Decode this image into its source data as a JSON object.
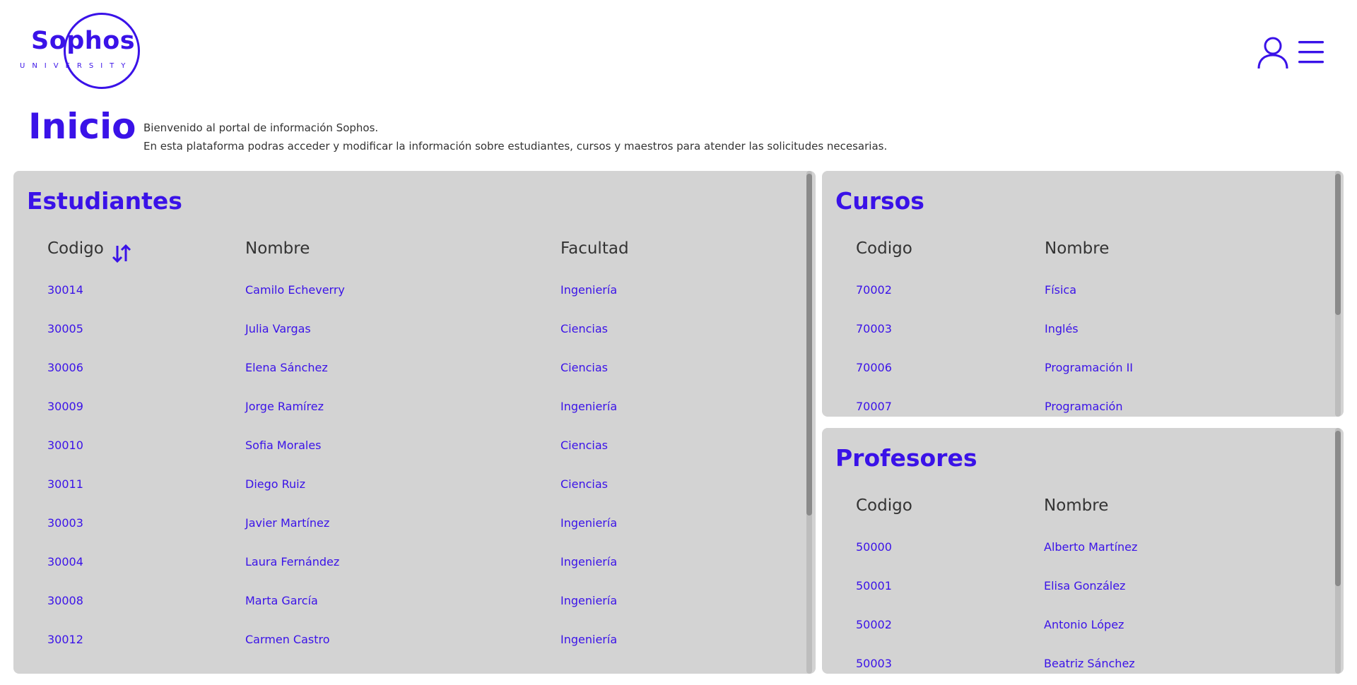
{
  "logo": {
    "word": "Sophos",
    "sub": "UNIVERSITY"
  },
  "header": {
    "title": "Inicio"
  },
  "welcome": {
    "line1": "Bienvenido al portal de información Sophos.",
    "line2": "En esta plataforma podras acceder y modificar la información sobre estudiantes, cursos y maestros para atender las solicitudes necesarias."
  },
  "icons": {
    "user": "user-icon",
    "menu": "hamburger-menu-icon",
    "sort": "sort-arrows-icon"
  },
  "colors": {
    "accent": "#3a12e8",
    "panel": "#d3d3d3"
  },
  "students": {
    "title": "Estudiantes",
    "headers": {
      "codigo": "Codigo",
      "nombre": "Nombre",
      "facultad": "Facultad"
    },
    "rows": [
      {
        "codigo": "30014",
        "nombre": "Camilo Echeverry",
        "facultad": "Ingeniería"
      },
      {
        "codigo": "30005",
        "nombre": "Julia Vargas",
        "facultad": "Ciencias"
      },
      {
        "codigo": "30006",
        "nombre": "Elena Sánchez",
        "facultad": "Ciencias"
      },
      {
        "codigo": "30009",
        "nombre": "Jorge Ramírez",
        "facultad": "Ingeniería"
      },
      {
        "codigo": "30010",
        "nombre": "Sofia Morales",
        "facultad": "Ciencias"
      },
      {
        "codigo": "30011",
        "nombre": "Diego Ruiz",
        "facultad": "Ciencias"
      },
      {
        "codigo": "30003",
        "nombre": "Javier Martínez",
        "facultad": "Ingeniería"
      },
      {
        "codigo": "30004",
        "nombre": "Laura Fernández",
        "facultad": "Ingeniería"
      },
      {
        "codigo": "30008",
        "nombre": "Marta García",
        "facultad": "Ingeniería"
      },
      {
        "codigo": "30012",
        "nombre": "Carmen Castro",
        "facultad": "Ingeniería"
      }
    ]
  },
  "courses": {
    "title": "Cursos",
    "headers": {
      "codigo": "Codigo",
      "nombre": "Nombre"
    },
    "rows": [
      {
        "codigo": "70002",
        "nombre": "Física"
      },
      {
        "codigo": "70003",
        "nombre": "Inglés"
      },
      {
        "codigo": "70006",
        "nombre": "Programación II"
      },
      {
        "codigo": "70007",
        "nombre": "Programación"
      }
    ]
  },
  "teachers": {
    "title": "Profesores",
    "headers": {
      "codigo": "Codigo",
      "nombre": "Nombre"
    },
    "rows": [
      {
        "codigo": "50000",
        "nombre": "Alberto Martínez"
      },
      {
        "codigo": "50001",
        "nombre": "Elisa González"
      },
      {
        "codigo": "50002",
        "nombre": "Antonio López"
      },
      {
        "codigo": "50003",
        "nombre": "Beatriz Sánchez"
      }
    ]
  }
}
